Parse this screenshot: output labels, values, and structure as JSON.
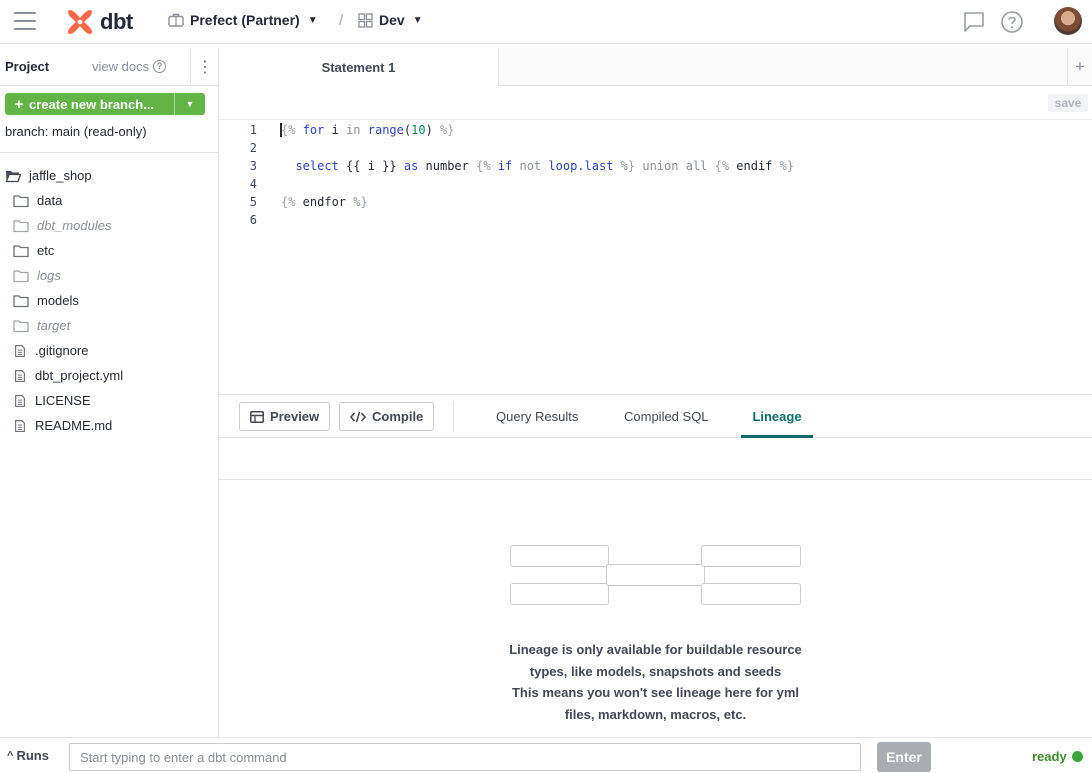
{
  "header": {
    "logo_text": "dbt",
    "project_name": "Prefect (Partner)",
    "separator": "/",
    "environment": "Dev",
    "accent_color": "#ff694a"
  },
  "sidebar": {
    "title": "Project",
    "view_docs": "view docs",
    "create_branch_label": "create new branch...",
    "branch_info": "branch: main (read-only)",
    "tree": [
      {
        "label": "jaffle_shop",
        "icon": "folder-open-icon",
        "root": true,
        "muted": false
      },
      {
        "label": "data",
        "icon": "folder-icon",
        "muted": false
      },
      {
        "label": "dbt_modules",
        "icon": "folder-icon",
        "muted": true
      },
      {
        "label": "etc",
        "icon": "folder-icon",
        "muted": false
      },
      {
        "label": "logs",
        "icon": "folder-icon",
        "muted": true
      },
      {
        "label": "models",
        "icon": "folder-icon",
        "muted": false
      },
      {
        "label": "target",
        "icon": "folder-icon",
        "muted": true
      },
      {
        "label": ".gitignore",
        "icon": "file-icon",
        "muted": false
      },
      {
        "label": "dbt_project.yml",
        "icon": "file-icon",
        "muted": false
      },
      {
        "label": "LICENSE",
        "icon": "file-icon",
        "muted": false
      },
      {
        "label": "README.md",
        "icon": "file-icon",
        "muted": false
      }
    ]
  },
  "editor": {
    "tab_label": "Statement 1",
    "save_label": "save",
    "line_numbers": [
      "1",
      "2",
      "3",
      "4",
      "5",
      "6"
    ]
  },
  "panel": {
    "preview_label": "Preview",
    "compile_label": "Compile",
    "tabs": [
      "Query Results",
      "Compiled SQL",
      "Lineage"
    ],
    "active_tab": "Lineage",
    "lineage_message_1": "Lineage is only available for buildable resource types, like models, snapshots and seeds",
    "lineage_message_2": "This means you won't see lineage here for yml files, markdown, macros, etc."
  },
  "footer": {
    "runs_label": "Runs",
    "command_placeholder": "Start typing to enter a dbt command",
    "enter_label": "Enter",
    "status": "ready",
    "status_color": "#3aa43a"
  }
}
